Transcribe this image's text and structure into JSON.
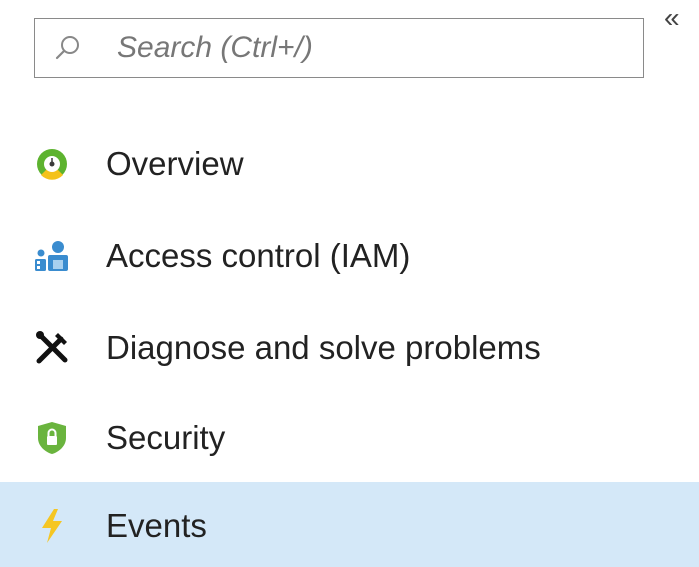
{
  "sidebar": {
    "collapse_glyph": "«",
    "search": {
      "placeholder": "Search (Ctrl+/)",
      "value": ""
    },
    "items": [
      {
        "label": "Overview",
        "icon": "overview-icon",
        "active": false
      },
      {
        "label": "Access control (IAM)",
        "icon": "users-icon",
        "active": false
      },
      {
        "label": "Diagnose and solve problems",
        "icon": "wrench-screwdriver-icon",
        "active": false
      },
      {
        "label": "Security",
        "icon": "shield-lock-icon",
        "active": false
      },
      {
        "label": "Events",
        "icon": "lightning-icon",
        "active": true
      }
    ]
  },
  "colors": {
    "active_background": "#d4e8f8",
    "overview_green": "#5db32f",
    "overview_yellow": "#f4c21a",
    "iam_blue": "#3a8ccf",
    "security_green": "#6ab43e",
    "events_yellow": "#f5c623"
  }
}
